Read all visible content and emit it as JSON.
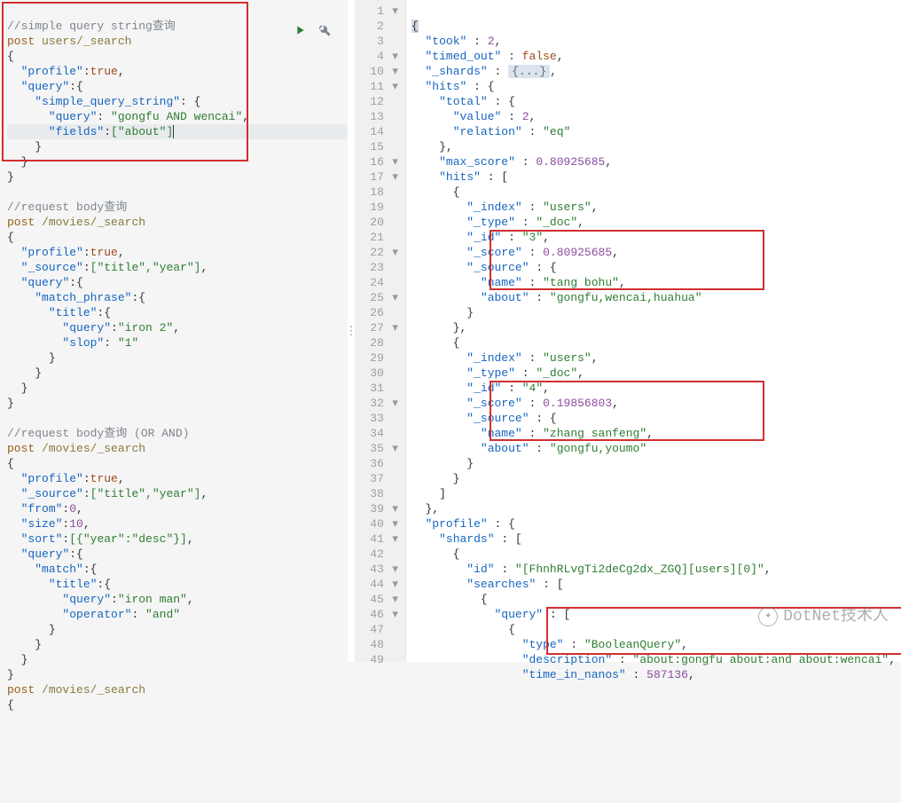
{
  "left": {
    "comment1": "//simple query string查询",
    "post1": "post",
    "path1": "users/_search",
    "profile_key": "\"profile\"",
    "profile_val": "true",
    "query_key": "\"query\"",
    "sqs_key": "\"simple_query_string\"",
    "inner_query_key": "\"query\"",
    "inner_query_val": "\"gongfu AND wencai\"",
    "fields_key": "\"fields\"",
    "fields_val": "[\"about\"]",
    "comment2": "//request body查询",
    "post2": "post",
    "path2": "/movies/_search",
    "source_key": "\"_source\"",
    "source_val": "[\"title\",\"year\"]",
    "match_phrase_key": "\"match_phrase\"",
    "title_key": "\"title\"",
    "mp_query_val": "\"iron 2\"",
    "slop_key": "\"slop\"",
    "slop_val": "\"1\"",
    "comment3": "//request body查询 (OR AND)",
    "from_key": "\"from\"",
    "from_val": "0",
    "size_key": "\"size\"",
    "size_val": "10",
    "sort_key": "\"sort\"",
    "sort_val": "[{\"year\":\"desc\"}]",
    "match_key": "\"match\"",
    "m_query_val": "\"iron man\"",
    "operator_key": "\"operator\"",
    "operator_val": "\"and\""
  },
  "right": {
    "took_key": "\"took\"",
    "took_val": "2",
    "timed_out_key": "\"timed_out\"",
    "timed_out_val": "false",
    "shards_key": "\"_shards\"",
    "shards_collapsed": "{...}",
    "hits_key": "\"hits\"",
    "total_key": "\"total\"",
    "value_key": "\"value\"",
    "value_val": "2",
    "relation_key": "\"relation\"",
    "relation_val": "\"eq\"",
    "max_score_key": "\"max_score\"",
    "max_score_val": "0.80925685",
    "hits_arr_key": "\"hits\"",
    "index_key": "\"_index\"",
    "index_val": "\"users\"",
    "type_key": "\"_type\"",
    "type_val": "\"_doc\"",
    "id_key": "\"_id\"",
    "id1_val": "\"3\"",
    "score_key": "\"_score\"",
    "score1_val": "0.80925685",
    "source_key": "\"_source\"",
    "name_key": "\"name\"",
    "name1_val": "\"tang bohu\"",
    "about_key": "\"about\"",
    "about1_val": "\"gongfu,wencai,huahua\"",
    "id2_val": "\"4\"",
    "score2_val": "0.19856803",
    "name2_val": "\"zhang sanfeng\"",
    "about2_val": "\"gongfu,youmo\"",
    "profile_key": "\"profile\"",
    "shards2_key": "\"shards\"",
    "id_key2": "\"id\"",
    "id_val2": "\"[FhnhRLvgTi2deCg2dx_ZGQ][users][0]\"",
    "searches_key": "\"searches\"",
    "query_key": "\"query\"",
    "qtype_key": "\"type\"",
    "qtype_val": "\"BooleanQuery\"",
    "desc_key": "\"description\"",
    "desc_val": "\"about:gongfu about:and about:wencai\"",
    "tin_key": "\"time_in_nanos\"",
    "tin_val": "587136",
    "line_numbers": [
      "1",
      "2",
      "3",
      "4",
      "10",
      "11",
      "12",
      "13",
      "14",
      "15",
      "16",
      "17",
      "18",
      "19",
      "20",
      "21",
      "22",
      "23",
      "24",
      "25",
      "26",
      "27",
      "28",
      "29",
      "30",
      "31",
      "32",
      "33",
      "34",
      "35",
      "36",
      "37",
      "38",
      "39",
      "40",
      "41",
      "42",
      "43",
      "44",
      "45",
      "46",
      "47",
      "48",
      "49"
    ]
  },
  "watermark": "DotNet技术人"
}
